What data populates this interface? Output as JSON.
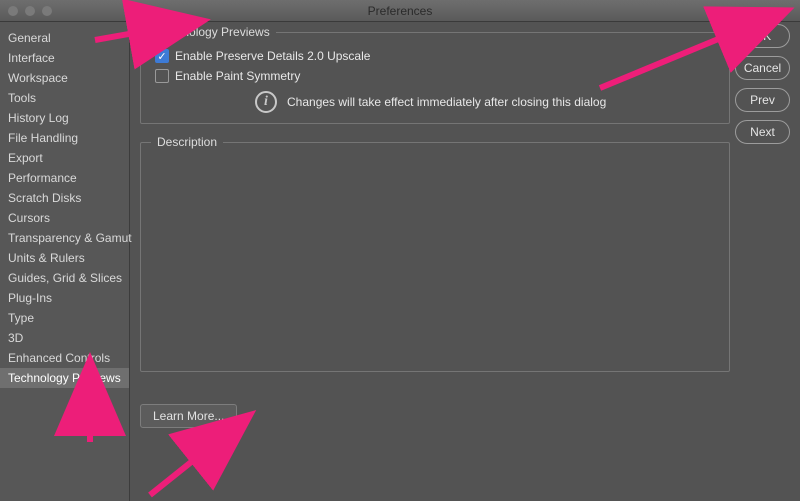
{
  "window": {
    "title": "Preferences"
  },
  "sidebar": {
    "items": [
      {
        "label": "General"
      },
      {
        "label": "Interface"
      },
      {
        "label": "Workspace"
      },
      {
        "label": "Tools"
      },
      {
        "label": "History Log"
      },
      {
        "label": "File Handling"
      },
      {
        "label": "Export"
      },
      {
        "label": "Performance"
      },
      {
        "label": "Scratch Disks"
      },
      {
        "label": "Cursors"
      },
      {
        "label": "Transparency & Gamut"
      },
      {
        "label": "Units & Rulers"
      },
      {
        "label": "Guides, Grid & Slices"
      },
      {
        "label": "Plug-Ins"
      },
      {
        "label": "Type"
      },
      {
        "label": "3D"
      },
      {
        "label": "Enhanced Controls"
      },
      {
        "label": "Technology Previews"
      }
    ],
    "selected_index": 17
  },
  "main": {
    "group_title": "Technology Previews",
    "checkbox1": {
      "label": "Enable Preserve Details 2.0 Upscale",
      "checked": true
    },
    "checkbox2": {
      "label": "Enable Paint Symmetry",
      "checked": false
    },
    "info_text": "Changes will take effect immediately after closing this dialog",
    "description_title": "Description",
    "learn_more": "Learn More..."
  },
  "buttons": {
    "ok": "OK",
    "cancel": "Cancel",
    "prev": "Prev",
    "next": "Next"
  },
  "annotations": {
    "color": "#ed1e79"
  }
}
